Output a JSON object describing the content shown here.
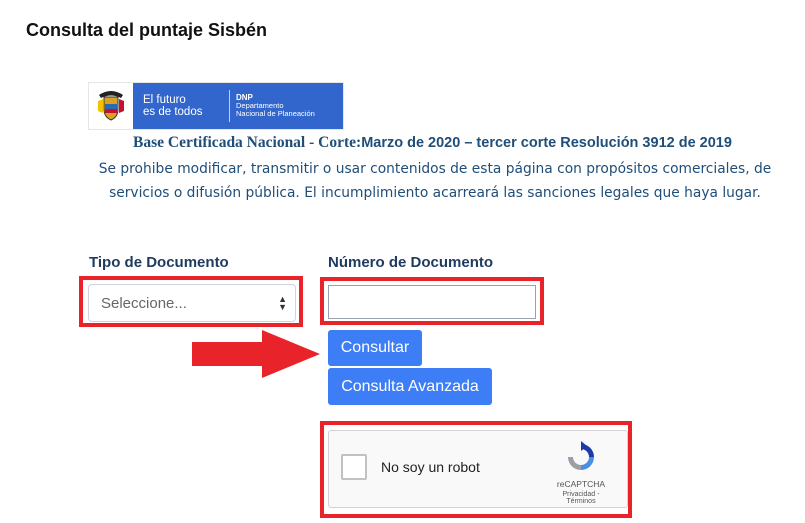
{
  "page": {
    "title": "Consulta del puntaje Sisbén"
  },
  "logo": {
    "tagline_1": "El futuro",
    "tagline_2": "es de todos",
    "dnp_abbr": "DNP",
    "dnp_line1": "Departamento",
    "dnp_line2": "Nacional de Planeación"
  },
  "notice": {
    "base_serif": "Base Certificada Nacional - Corte:",
    "base_rest": "Marzo de 2020 – tercer corte Resolución 3912 de 2019",
    "disclaimer": "Se prohibe modificar, transmitir o usar contenidos de esta página con propósitos comerciales, de servicios o difusión pública. El incumplimiento acarreará las sanciones legales que haya lugar."
  },
  "form": {
    "doc_type_label": "Tipo de Documento",
    "doc_type_selected": "Seleccione...",
    "doc_number_label": "Número de Documento",
    "doc_number_value": "",
    "consultar_label": "Consultar",
    "consulta_avanzada_label": "Consulta Avanzada"
  },
  "recaptcha": {
    "checkbox_label": "No soy un robot",
    "brand": "reCAPTCHA",
    "privacy": "Privacidad",
    "terms": "Términos",
    "separator": " - "
  },
  "colors": {
    "accent_blue": "#3d7df6",
    "brand_blue": "#3366cc",
    "text_blue": "#1f4e79",
    "highlight_red": "#e8232a"
  },
  "icons": [
    "colombia-crest-icon",
    "select-arrows-icon",
    "red-arrow-icon",
    "recaptcha-logo-icon"
  ]
}
